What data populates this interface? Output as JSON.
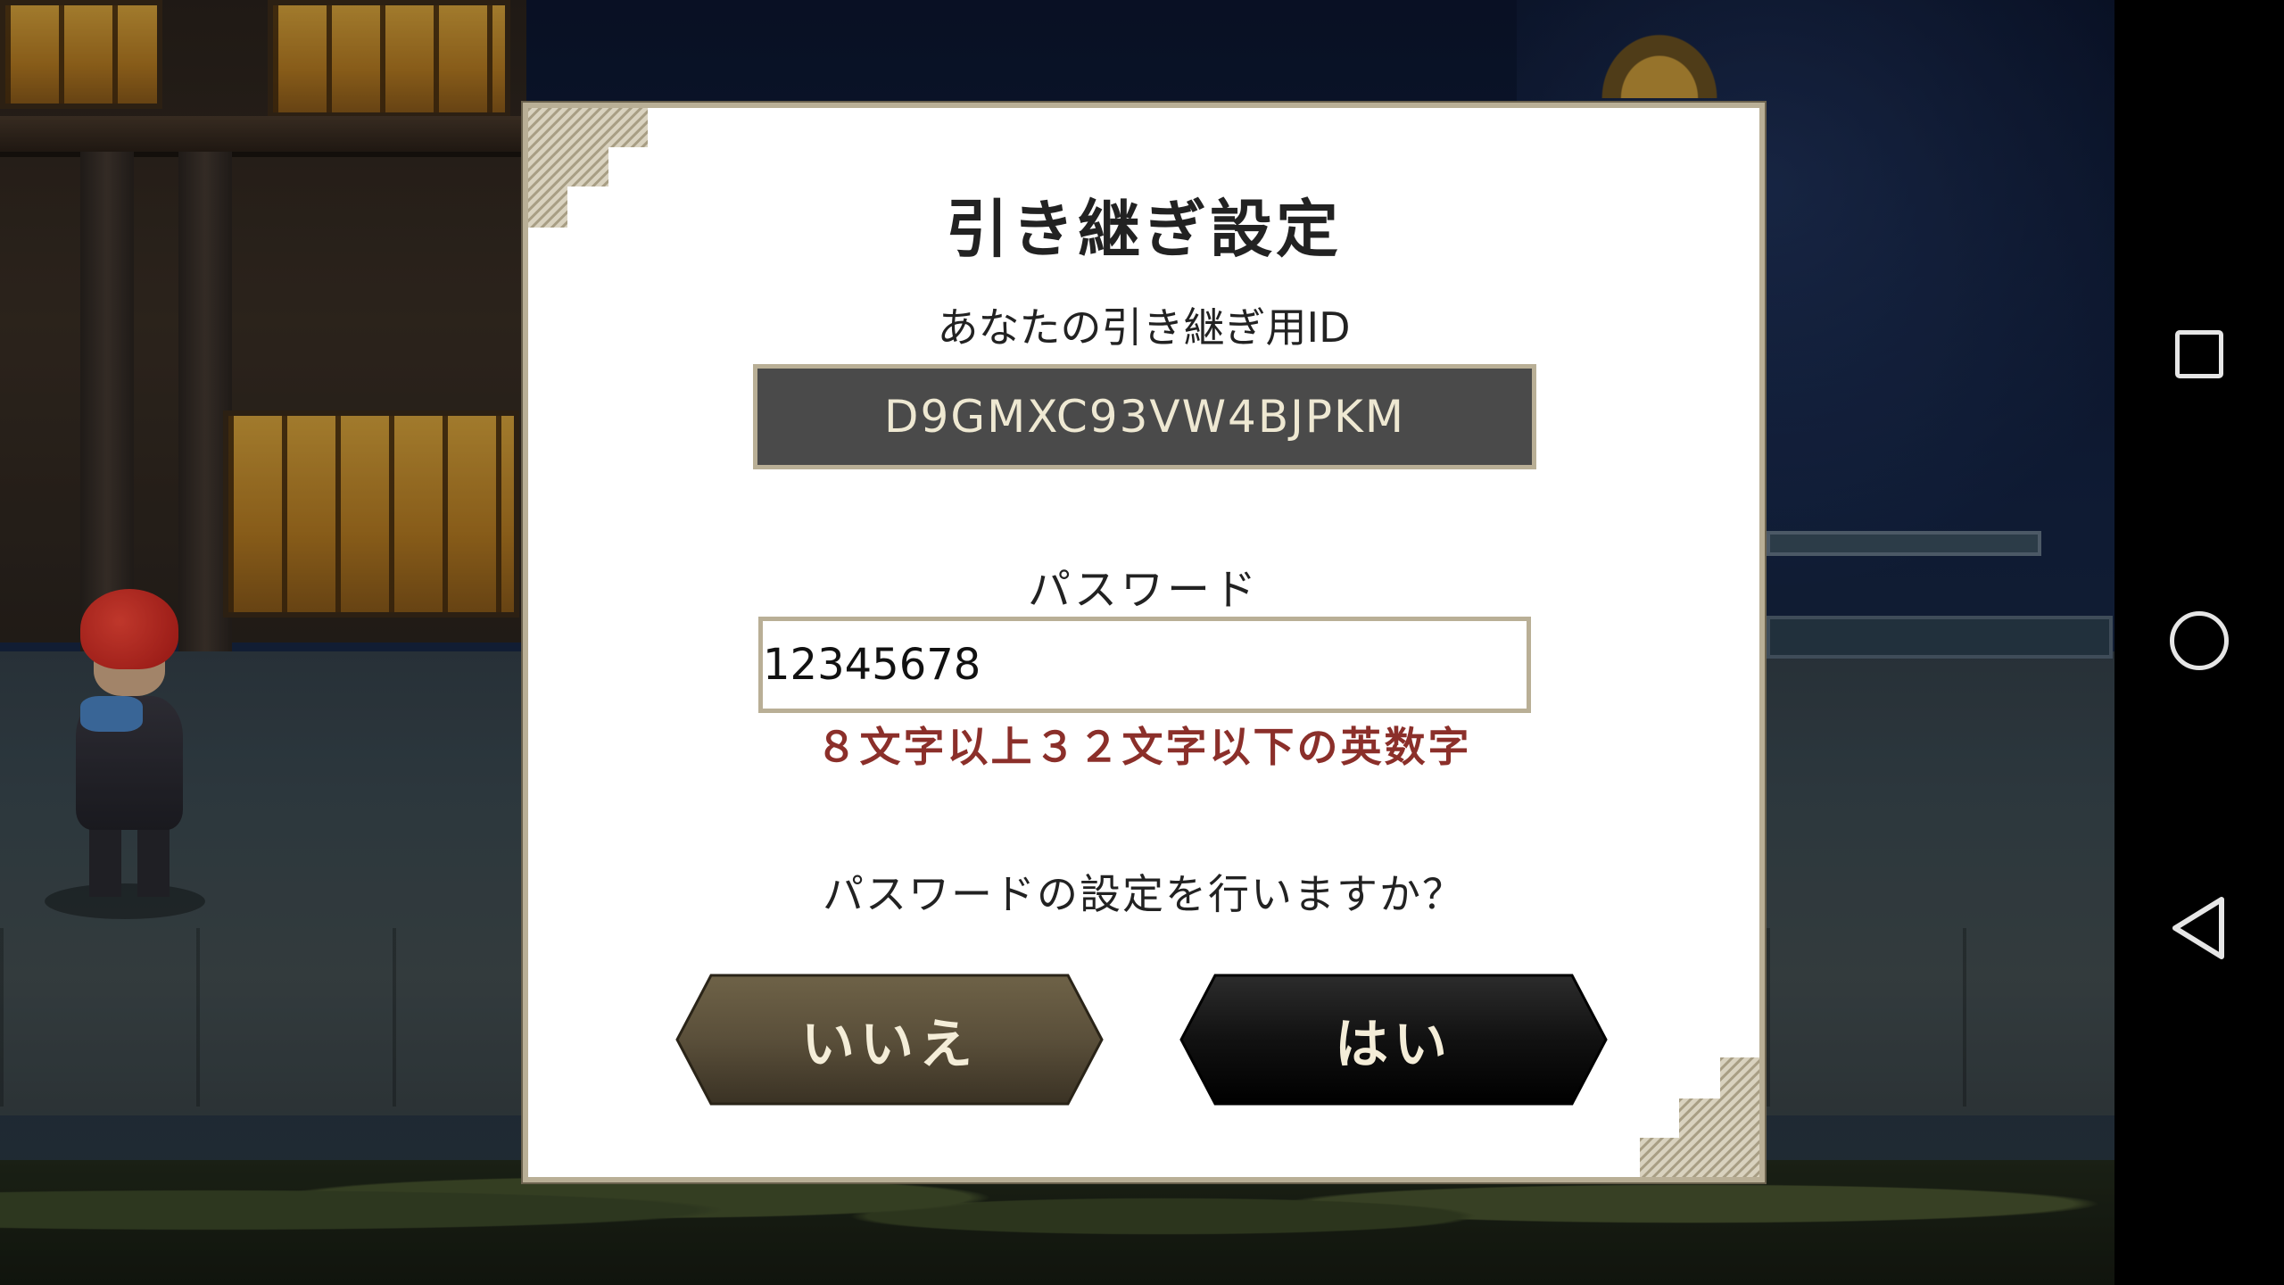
{
  "dialog": {
    "title": "引き継ぎ設定",
    "id_label": "あなたの引き継ぎ用ID",
    "id_value": "D9GMXC93VW4BJPKM",
    "password_label": "パスワード",
    "password_value": "12345678",
    "password_hint": "８文字以上３２文字以下の英数字",
    "question": "パスワードの設定を行いますか？",
    "no_button": "いいえ",
    "yes_button": "はい"
  },
  "navbar": {
    "icons": [
      "recents-square-icon",
      "home-circle-icon",
      "back-triangle-icon"
    ]
  },
  "colors": {
    "dialog_border": "#b9af96",
    "id_box_bg": "#4a4a4a",
    "hint_text": "#8b2f2a",
    "no_button_bg": "#5a4f3a",
    "yes_button_bg": "#111111"
  }
}
